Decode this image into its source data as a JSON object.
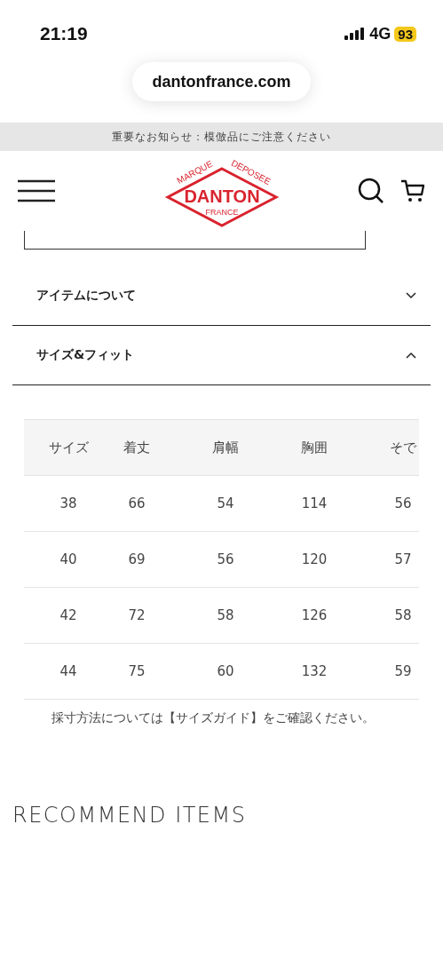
{
  "status_bar": {
    "time": "21:19",
    "network": "4G",
    "battery": "93"
  },
  "address_bar": {
    "url": "dantonfrance.com"
  },
  "notice": "重要なお知らせ：模倣品にご注意ください",
  "logo": {
    "top_left": "MARQUE",
    "top_right": "DEPOSEE",
    "name": "DANTON",
    "bottom": "FRANCE"
  },
  "accordions": [
    {
      "label": "アイテムについて",
      "expanded": false
    },
    {
      "label": "サイズ&フィット",
      "expanded": true
    }
  ],
  "size_table": {
    "columns": [
      "サイズ",
      "着丈",
      "肩幅",
      "胸囲",
      "そで"
    ],
    "rows": [
      [
        "38",
        "66",
        "54",
        "114",
        "56"
      ],
      [
        "40",
        "69",
        "56",
        "120",
        "57"
      ],
      [
        "42",
        "72",
        "58",
        "126",
        "58"
      ],
      [
        "44",
        "75",
        "60",
        "132",
        "59"
      ]
    ]
  },
  "size_note": "採寸方法については【サイズガイド】をご確認ください。",
  "section_title": "RECOMMEND ITEMS"
}
